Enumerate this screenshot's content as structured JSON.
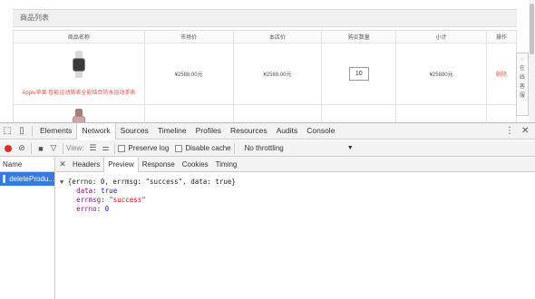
{
  "page": {
    "section_title": "商品列表",
    "table": {
      "headers": [
        "商品名称",
        "市场价",
        "本店价",
        "购买数量",
        "小计",
        "操作"
      ],
      "rows": [
        {
          "product_name": "Apple苹果 智能运动腕表全能结合防水运动手表",
          "market_price": "¥2588.00元",
          "shop_price": "¥2588.00元",
          "quantity": "10",
          "subtotal": "¥25880元",
          "action": "删除"
        }
      ]
    },
    "float_sidebar": [
      "在",
      "线",
      "客",
      "服"
    ]
  },
  "devtools": {
    "tabs": [
      "Elements",
      "Network",
      "Sources",
      "Timeline",
      "Profiles",
      "Resources",
      "Audits",
      "Console"
    ],
    "active_tab": "Network",
    "toolbar": {
      "view_label": "View:",
      "preserve_log": "Preserve log",
      "disable_cache": "Disable cache",
      "throttling": "No throttling"
    },
    "requests": {
      "column_name": "Name",
      "selected_request": "deleteProdu..."
    },
    "detail_tabs": [
      "Headers",
      "Preview",
      "Response",
      "Cookies",
      "Timing"
    ],
    "active_detail_tab": "Preview",
    "preview": {
      "summary": "{errno: 0, errmsg: \"success\", data: true}",
      "fields": [
        {
          "key": "data",
          "value": "true"
        },
        {
          "key": "errmsg",
          "value": "\"success\""
        },
        {
          "key": "errno",
          "value": "0"
        }
      ]
    },
    "colors": {
      "accent": "#3879d9",
      "record": "#d93025",
      "key": "#881391",
      "string": "#c41a16"
    }
  }
}
